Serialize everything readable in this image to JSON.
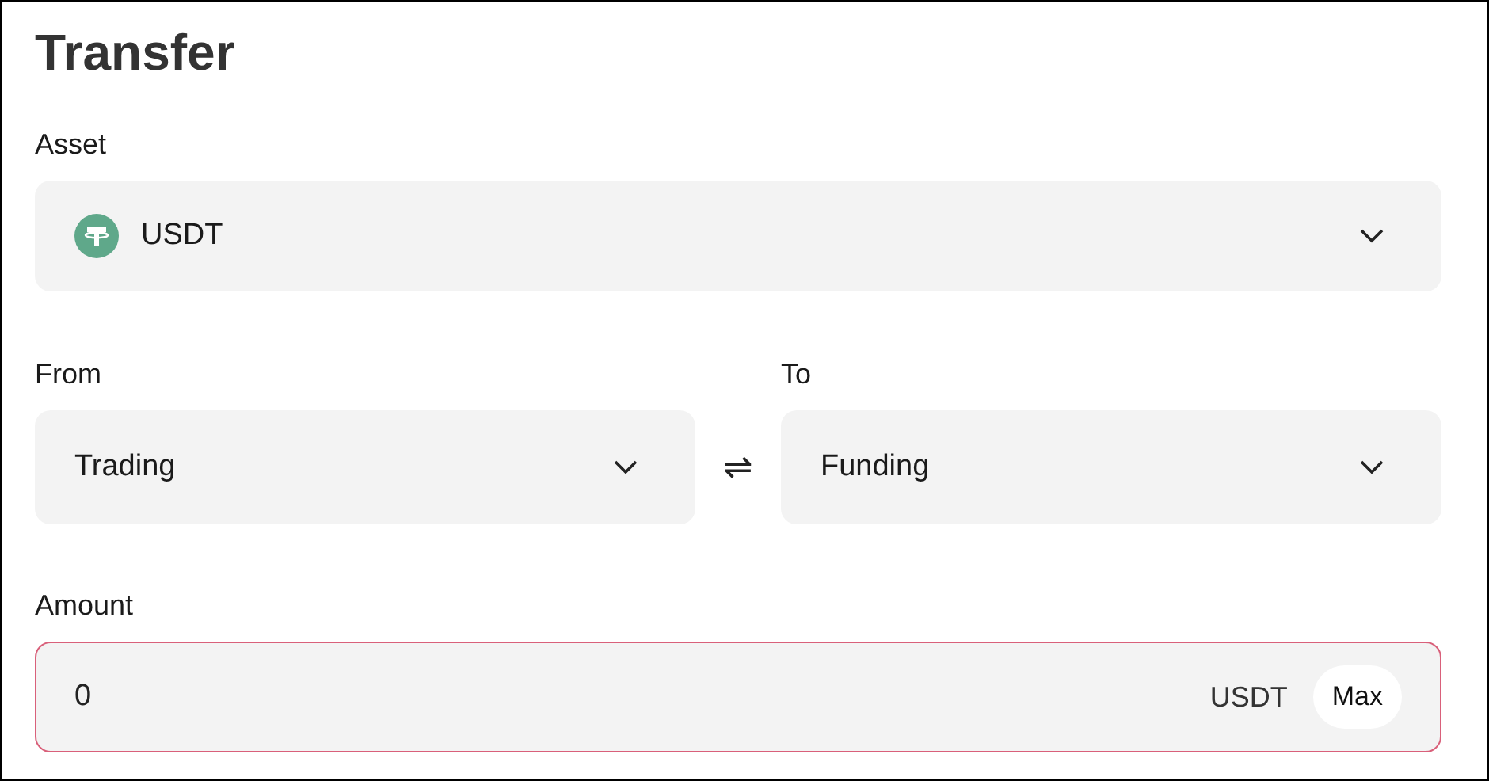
{
  "title": "Transfer",
  "asset": {
    "label": "Asset",
    "value": "USDT"
  },
  "from": {
    "label": "From",
    "value": "Trading"
  },
  "to": {
    "label": "To",
    "value": "Funding"
  },
  "swap": {
    "symbol": "⇌"
  },
  "amount": {
    "label": "Amount",
    "value": "0",
    "unit": "USDT",
    "max_button": "Max",
    "invalid": true
  }
}
